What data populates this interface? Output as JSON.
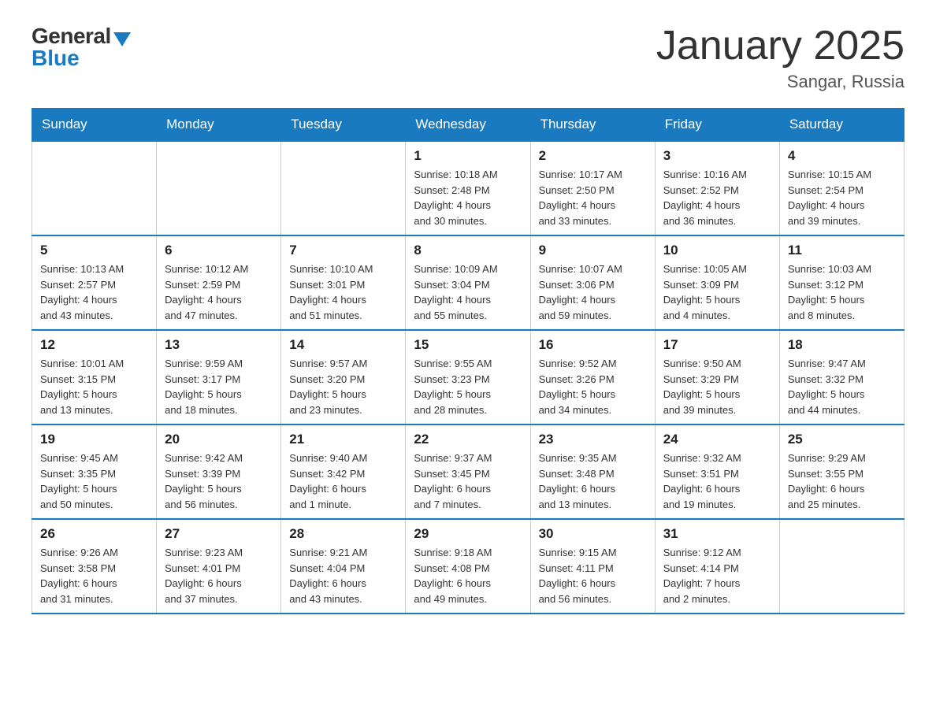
{
  "header": {
    "logo_general": "General",
    "logo_blue": "Blue",
    "title": "January 2025",
    "location": "Sangar, Russia"
  },
  "days_of_week": [
    "Sunday",
    "Monday",
    "Tuesday",
    "Wednesday",
    "Thursday",
    "Friday",
    "Saturday"
  ],
  "weeks": [
    {
      "days": [
        {
          "number": "",
          "info": ""
        },
        {
          "number": "",
          "info": ""
        },
        {
          "number": "",
          "info": ""
        },
        {
          "number": "1",
          "info": "Sunrise: 10:18 AM\nSunset: 2:48 PM\nDaylight: 4 hours\nand 30 minutes."
        },
        {
          "number": "2",
          "info": "Sunrise: 10:17 AM\nSunset: 2:50 PM\nDaylight: 4 hours\nand 33 minutes."
        },
        {
          "number": "3",
          "info": "Sunrise: 10:16 AM\nSunset: 2:52 PM\nDaylight: 4 hours\nand 36 minutes."
        },
        {
          "number": "4",
          "info": "Sunrise: 10:15 AM\nSunset: 2:54 PM\nDaylight: 4 hours\nand 39 minutes."
        }
      ]
    },
    {
      "days": [
        {
          "number": "5",
          "info": "Sunrise: 10:13 AM\nSunset: 2:57 PM\nDaylight: 4 hours\nand 43 minutes."
        },
        {
          "number": "6",
          "info": "Sunrise: 10:12 AM\nSunset: 2:59 PM\nDaylight: 4 hours\nand 47 minutes."
        },
        {
          "number": "7",
          "info": "Sunrise: 10:10 AM\nSunset: 3:01 PM\nDaylight: 4 hours\nand 51 minutes."
        },
        {
          "number": "8",
          "info": "Sunrise: 10:09 AM\nSunset: 3:04 PM\nDaylight: 4 hours\nand 55 minutes."
        },
        {
          "number": "9",
          "info": "Sunrise: 10:07 AM\nSunset: 3:06 PM\nDaylight: 4 hours\nand 59 minutes."
        },
        {
          "number": "10",
          "info": "Sunrise: 10:05 AM\nSunset: 3:09 PM\nDaylight: 5 hours\nand 4 minutes."
        },
        {
          "number": "11",
          "info": "Sunrise: 10:03 AM\nSunset: 3:12 PM\nDaylight: 5 hours\nand 8 minutes."
        }
      ]
    },
    {
      "days": [
        {
          "number": "12",
          "info": "Sunrise: 10:01 AM\nSunset: 3:15 PM\nDaylight: 5 hours\nand 13 minutes."
        },
        {
          "number": "13",
          "info": "Sunrise: 9:59 AM\nSunset: 3:17 PM\nDaylight: 5 hours\nand 18 minutes."
        },
        {
          "number": "14",
          "info": "Sunrise: 9:57 AM\nSunset: 3:20 PM\nDaylight: 5 hours\nand 23 minutes."
        },
        {
          "number": "15",
          "info": "Sunrise: 9:55 AM\nSunset: 3:23 PM\nDaylight: 5 hours\nand 28 minutes."
        },
        {
          "number": "16",
          "info": "Sunrise: 9:52 AM\nSunset: 3:26 PM\nDaylight: 5 hours\nand 34 minutes."
        },
        {
          "number": "17",
          "info": "Sunrise: 9:50 AM\nSunset: 3:29 PM\nDaylight: 5 hours\nand 39 minutes."
        },
        {
          "number": "18",
          "info": "Sunrise: 9:47 AM\nSunset: 3:32 PM\nDaylight: 5 hours\nand 44 minutes."
        }
      ]
    },
    {
      "days": [
        {
          "number": "19",
          "info": "Sunrise: 9:45 AM\nSunset: 3:35 PM\nDaylight: 5 hours\nand 50 minutes."
        },
        {
          "number": "20",
          "info": "Sunrise: 9:42 AM\nSunset: 3:39 PM\nDaylight: 5 hours\nand 56 minutes."
        },
        {
          "number": "21",
          "info": "Sunrise: 9:40 AM\nSunset: 3:42 PM\nDaylight: 6 hours\nand 1 minute."
        },
        {
          "number": "22",
          "info": "Sunrise: 9:37 AM\nSunset: 3:45 PM\nDaylight: 6 hours\nand 7 minutes."
        },
        {
          "number": "23",
          "info": "Sunrise: 9:35 AM\nSunset: 3:48 PM\nDaylight: 6 hours\nand 13 minutes."
        },
        {
          "number": "24",
          "info": "Sunrise: 9:32 AM\nSunset: 3:51 PM\nDaylight: 6 hours\nand 19 minutes."
        },
        {
          "number": "25",
          "info": "Sunrise: 9:29 AM\nSunset: 3:55 PM\nDaylight: 6 hours\nand 25 minutes."
        }
      ]
    },
    {
      "days": [
        {
          "number": "26",
          "info": "Sunrise: 9:26 AM\nSunset: 3:58 PM\nDaylight: 6 hours\nand 31 minutes."
        },
        {
          "number": "27",
          "info": "Sunrise: 9:23 AM\nSunset: 4:01 PM\nDaylight: 6 hours\nand 37 minutes."
        },
        {
          "number": "28",
          "info": "Sunrise: 9:21 AM\nSunset: 4:04 PM\nDaylight: 6 hours\nand 43 minutes."
        },
        {
          "number": "29",
          "info": "Sunrise: 9:18 AM\nSunset: 4:08 PM\nDaylight: 6 hours\nand 49 minutes."
        },
        {
          "number": "30",
          "info": "Sunrise: 9:15 AM\nSunset: 4:11 PM\nDaylight: 6 hours\nand 56 minutes."
        },
        {
          "number": "31",
          "info": "Sunrise: 9:12 AM\nSunset: 4:14 PM\nDaylight: 7 hours\nand 2 minutes."
        },
        {
          "number": "",
          "info": ""
        }
      ]
    }
  ]
}
